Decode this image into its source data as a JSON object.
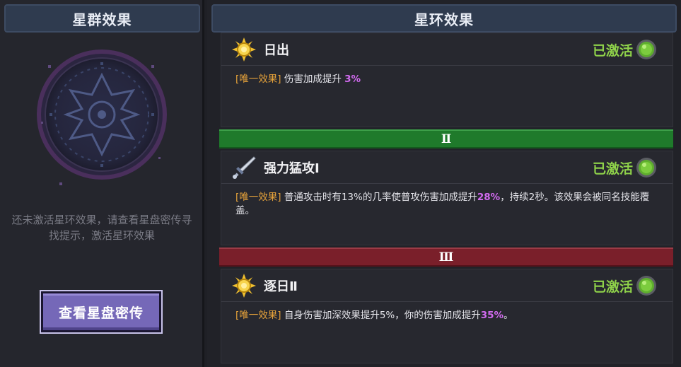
{
  "left_panel": {
    "title": "星群效果",
    "hint": "还未激活星环效果，请查看星盘密传寻找提示，激活星环效果",
    "button_label": "查看星盘密传"
  },
  "right_panel": {
    "title": "星环效果",
    "tiers": [
      {
        "numeral": "Ⅱ",
        "color": "#1f7a2b"
      },
      {
        "numeral": "Ⅲ",
        "color": "#7a1f2a"
      }
    ],
    "effects": [
      {
        "icon": "sun-icon",
        "name": "日出",
        "status": "已激活",
        "tag": "[唯一效果]",
        "desc_before": "伤害加成提升",
        "highlight": "3%",
        "desc_after": ""
      },
      {
        "icon": "sword-icon",
        "name": "强力猛攻Ⅰ",
        "status": "已激活",
        "tag": "[唯一效果]",
        "desc_before": "普通攻击时有13%的几率使普攻伤害加成提升",
        "highlight": "28%",
        "desc_after": "，持续2秒。该效果会被同名技能覆盖。"
      },
      {
        "icon": "sun-icon",
        "name": "逐日Ⅱ",
        "status": "已激活",
        "tag": "[唯一效果]",
        "desc_before": "自身伤害加深效果提升5%，你的伤害加成提升",
        "highlight": "35%",
        "desc_after": "。"
      }
    ]
  },
  "colors": {
    "active_status": "#8fd24a",
    "tag": "#e6a23a",
    "highlight": "#d26bf0",
    "button": "#7568b8"
  }
}
